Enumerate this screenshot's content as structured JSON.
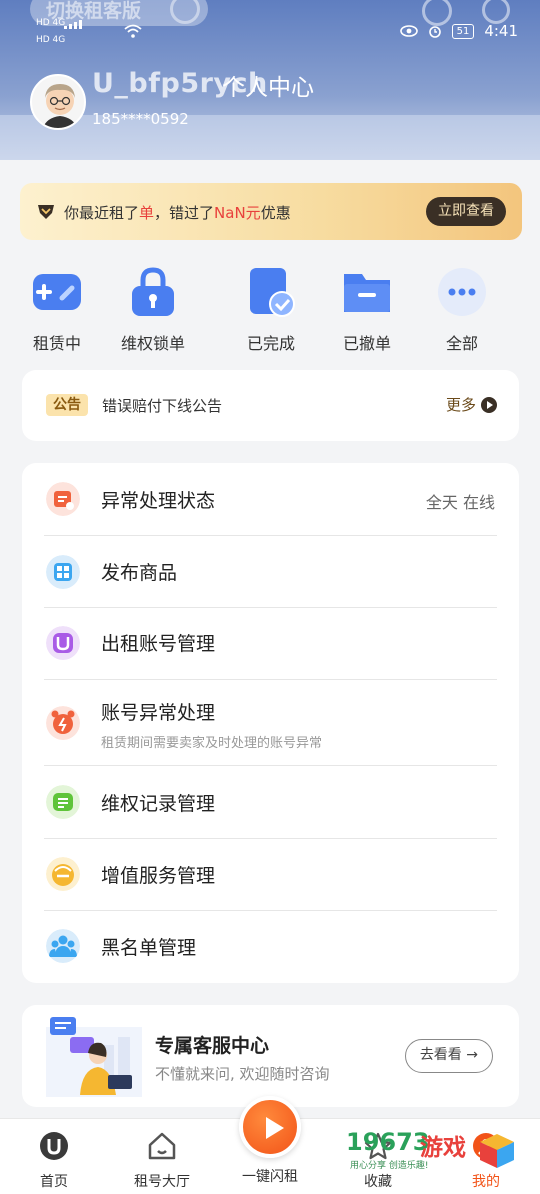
{
  "status_bar": {
    "network_left": "HD 4G",
    "network_left2": "HD 4G",
    "battery": "51",
    "time": "4:41"
  },
  "header": {
    "switch_label": "切换租客版",
    "username": "U_bfp5rych",
    "title": "个人中心",
    "phone": "185****0592"
  },
  "promo": {
    "text_prefix": "你最近租了",
    "text_highlight1": "单",
    "text_middle": "，错过了",
    "text_highlight2": "NaN元",
    "text_suffix": "优惠",
    "button": "立即查看"
  },
  "shortcuts": [
    {
      "label": "租赁中",
      "icon": "gamepad-icon"
    },
    {
      "label": "维权锁单",
      "icon": "lock-icon"
    },
    {
      "label": "已完成",
      "icon": "completed-check-icon"
    },
    {
      "label": "已撤单",
      "icon": "folder-icon"
    },
    {
      "label": "全部",
      "icon": "more-dots-icon"
    }
  ],
  "notice": {
    "tag": "公告",
    "message": "错误赔付下线公告",
    "more": "更多"
  },
  "menu": [
    {
      "title": "异常处理状态",
      "right": "全天 在线",
      "subtitle": ""
    },
    {
      "title": "发布商品",
      "right": "",
      "subtitle": ""
    },
    {
      "title": "出租账号管理",
      "right": "",
      "subtitle": ""
    },
    {
      "title": "账号异常处理",
      "right": "",
      "subtitle": "租赁期间需要卖家及时处理的账号异常"
    },
    {
      "title": "维权记录管理",
      "right": "",
      "subtitle": ""
    },
    {
      "title": "增值服务管理",
      "right": "",
      "subtitle": ""
    },
    {
      "title": "黑名单管理",
      "right": "",
      "subtitle": ""
    }
  ],
  "service": {
    "title": "专属客服中心",
    "subtitle": "不懂就来问, 欢迎随时咨询",
    "button": "去看看"
  },
  "tabbar": {
    "home": "首页",
    "market": "租号大厅",
    "flash": "一键闪租",
    "favorites": "收藏",
    "mine": "我的"
  },
  "watermark": {
    "number": "19673",
    "brand": "游戏",
    "slogan": "用心分享  创造乐趣!"
  },
  "colors": {
    "accent_red": "#e8413c",
    "header_blue": "#6e8cc8",
    "flash_orange": "#f25318"
  }
}
